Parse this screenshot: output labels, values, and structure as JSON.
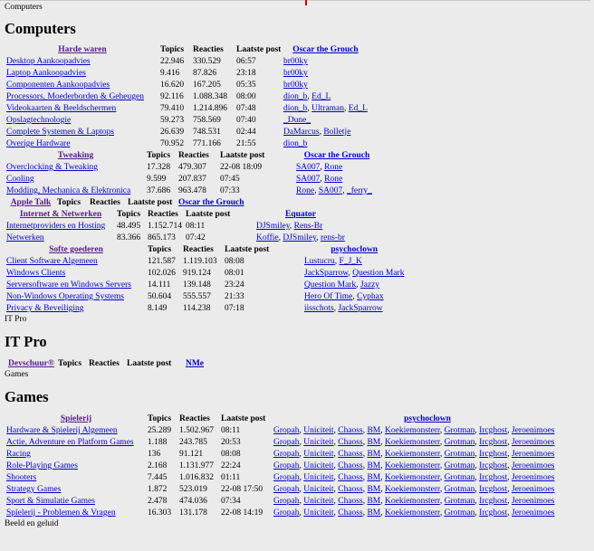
{
  "page": {
    "breadcrumb": "Computers"
  },
  "sections": [
    {
      "title": "Computers",
      "groups": [
        {
          "name": "Harde waren",
          "moderator": "Oscar the Grouch",
          "headers": {
            "topics": "Topics",
            "reacties": "Reacties",
            "laatste": "Laatste post"
          },
          "forums": [
            {
              "name": "Desktop Aankoopadvies",
              "topics": "22.946",
              "reacties": "330.529",
              "last": "06:57",
              "mods": [
                "br00ky"
              ]
            },
            {
              "name": "Laptop Aankoopadvies",
              "topics": "9.416",
              "reacties": "87.826",
              "last": "23:18",
              "mods": [
                "br00ky"
              ]
            },
            {
              "name": "Componenten Aankoopadvies",
              "topics": "16.620",
              "reacties": "167.205",
              "last": "05:35",
              "mods": [
                "br00ky"
              ]
            },
            {
              "name": "Processors, Moederborden & Geheugen",
              "topics": "92.116",
              "reacties": "1.088.348",
              "last": "08:00",
              "mods": [
                "dion_b",
                "Ed_L"
              ]
            },
            {
              "name": "Videokaarten & Beeldschermen",
              "topics": "79.410",
              "reacties": "1.214.896",
              "last": "07:48",
              "mods": [
                "dion_b",
                "Ultraman",
                "Ed_L"
              ]
            },
            {
              "name": "Opslagtechnologie",
              "topics": "59.273",
              "reacties": "758.569",
              "last": "07:40",
              "mods": [
                "_Dune_"
              ]
            },
            {
              "name": "Complete Systemen & Laptops",
              "topics": "26.639",
              "reacties": "748.531",
              "last": "02:44",
              "mods": [
                "DaMarcus",
                "Bolletje"
              ]
            },
            {
              "name": "Overige Hardware",
              "topics": "70.952",
              "reacties": "771.166",
              "last": "21:55",
              "mods": [
                "dion_b"
              ]
            }
          ]
        },
        {
          "name": "Tweaking",
          "moderator": "Oscar the Grouch",
          "headers": {
            "topics": "Topics",
            "reacties": "Reacties",
            "laatste": "Laatste post"
          },
          "forums": [
            {
              "name": "Overclocking & Tweaking",
              "topics": "17.328",
              "reacties": "479.307",
              "last": "22-08 18:09",
              "mods": [
                "SA007",
                "Rone"
              ]
            },
            {
              "name": "Cooling",
              "topics": "9.599",
              "reacties": "207.837",
              "last": "07:45",
              "mods": [
                "SA007",
                "Rone"
              ]
            },
            {
              "name": "Modding, Mechanica & Elektronica",
              "topics": "37.686",
              "reacties": "963.478",
              "last": "07:33",
              "mods": [
                "Rone",
                "SA007",
                "_ferry_"
              ]
            }
          ]
        },
        {
          "name": "Apple Talk",
          "moderator": "Oscar the Grouch",
          "headers": {
            "topics": "Topics",
            "reacties": "Reacties",
            "laatste": "Laatste post"
          },
          "forums": []
        },
        {
          "name": "Internet & Netwerken",
          "moderator": "Equator",
          "headers": {
            "topics": "Topics",
            "reacties": "Reacties",
            "laatste": "Laatste post"
          },
          "forums": [
            {
              "name": "Internetproviders en Hosting",
              "topics": "48.495",
              "reacties": "1.152.714",
              "last": "08:11",
              "mods": [
                "DJSmiley",
                "Rens-Br"
              ]
            },
            {
              "name": "Netwerken",
              "topics": "83.366",
              "reacties": "865.173",
              "last": "07:42",
              "mods": [
                "Koffie",
                "DJSmiley",
                "rens-br"
              ]
            }
          ]
        },
        {
          "name": "Softe goederen",
          "moderator": "psychoclown",
          "headers": {
            "topics": "Topics",
            "reacties": "Reacties",
            "laatste": "Laatste post"
          },
          "forums": [
            {
              "name": "Client Software Algemeen",
              "topics": "121.587",
              "reacties": "1.119.103",
              "last": "08:08",
              "mods": [
                "Lustucru",
                "F_J_K"
              ]
            },
            {
              "name": "Windows Clients",
              "topics": "102.026",
              "reacties": "919.124",
              "last": "08:01",
              "mods": [
                "JackSparrow",
                "Question Mark"
              ]
            },
            {
              "name": "Serversoftware en Windows Servers",
              "topics": "14.111",
              "reacties": "139.148",
              "last": "23:24",
              "mods": [
                "Question Mark",
                "Jazzy"
              ]
            },
            {
              "name": "Non-Windows Operating Systems",
              "topics": "50.604",
              "reacties": "555.557",
              "last": "21:33",
              "mods": [
                "Hero Of Time",
                "Cyphax"
              ]
            },
            {
              "name": "Privacy & Beveiliging",
              "topics": "8.149",
              "reacties": "114.238",
              "last": "07:18",
              "mods": [
                "iisschots",
                "JackSparrow"
              ]
            }
          ]
        }
      ]
    },
    {
      "label_before": "IT Pro",
      "title": "IT Pro",
      "groups": [
        {
          "name": "Devschuur®",
          "moderator": "NMe",
          "headers": {
            "topics": "Topics",
            "reacties": "Reacties",
            "laatste": "Laatste post"
          },
          "forums": []
        }
      ]
    },
    {
      "label_before": "Games",
      "title": "Games",
      "groups": [
        {
          "name": "Spielerij",
          "moderator": "psychoclown",
          "headers": {
            "topics": "Topics",
            "reacties": "Reacties",
            "laatste": "Laatste post"
          },
          "forums": [
            {
              "name": "Hardware & Spielerij Algemeen",
              "topics": "25.289",
              "reacties": "1.502.967",
              "last": "08:11",
              "mods": [
                "Gropah",
                "Uniciteit",
                "Chaoss",
                "BM",
                "Koekiemonsterr",
                "Grotman",
                "Ircghost",
                "Jeroenimoes"
              ]
            },
            {
              "name": "Actie, Adventure en Platform Games",
              "topics": "1.188",
              "reacties": "243.785",
              "last": "20:53",
              "mods": [
                "Gropah",
                "Uniciteit",
                "Chaoss",
                "BM",
                "Koekiemonsterr",
                "Grotman",
                "Ircghost",
                "Jeroenimoes"
              ]
            },
            {
              "name": "Racing",
              "topics": "136",
              "reacties": "91.121",
              "last": "08:08",
              "mods": [
                "Gropah",
                "Uniciteit",
                "Chaoss",
                "BM",
                "Koekiemonsterr",
                "Grotman",
                "Ircghost",
                "Jeroenimoes"
              ]
            },
            {
              "name": "Role-Playing Games",
              "topics": "2.168",
              "reacties": "1.131.977",
              "last": "22:24",
              "mods": [
                "Gropah",
                "Uniciteit",
                "Chaoss",
                "BM",
                "Koekiemonsterr",
                "Grotman",
                "Ircghost",
                "Jeroenimoes"
              ]
            },
            {
              "name": "Shooters",
              "topics": "7.445",
              "reacties": "1.016.832",
              "last": "01:11",
              "mods": [
                "Gropah",
                "Uniciteit",
                "Chaoss",
                "BM",
                "Koekiemonsterr",
                "Grotman",
                "Ircghost",
                "Jeroenimoes"
              ]
            },
            {
              "name": "Strategy Games",
              "topics": "1.872",
              "reacties": "523.019",
              "last": "22-08 17:50",
              "mods": [
                "Gropah",
                "Uniciteit",
                "Chaoss",
                "BM",
                "Koekiemonsterr",
                "Grotman",
                "Ircghost",
                "Jeroenimoes"
              ]
            },
            {
              "name": "Sport & Simulatie Games",
              "topics": "2.478",
              "reacties": "474.036",
              "last": "07:34",
              "mods": [
                "Gropah",
                "Uniciteit",
                "Chaoss",
                "BM",
                "Koekiemonsterr",
                "Grotman",
                "Ircghost",
                "Jeroenimoes"
              ]
            },
            {
              "name": "Spielerij - Problemen & Vragen",
              "topics": "16.303",
              "reacties": "131.178",
              "last": "22-08 14:19",
              "mods": [
                "Gropah",
                "Uniciteit",
                "Chaoss",
                "BM",
                "Koekiemonsterr",
                "Grotman",
                "Ircghost",
                "Jeroenimoes"
              ]
            }
          ]
        }
      ]
    }
  ],
  "footer_label": "Beeld en geluid",
  "colors": {
    "link": "#0000cc",
    "visited": "#551a8b",
    "background": "#ebebeb"
  }
}
